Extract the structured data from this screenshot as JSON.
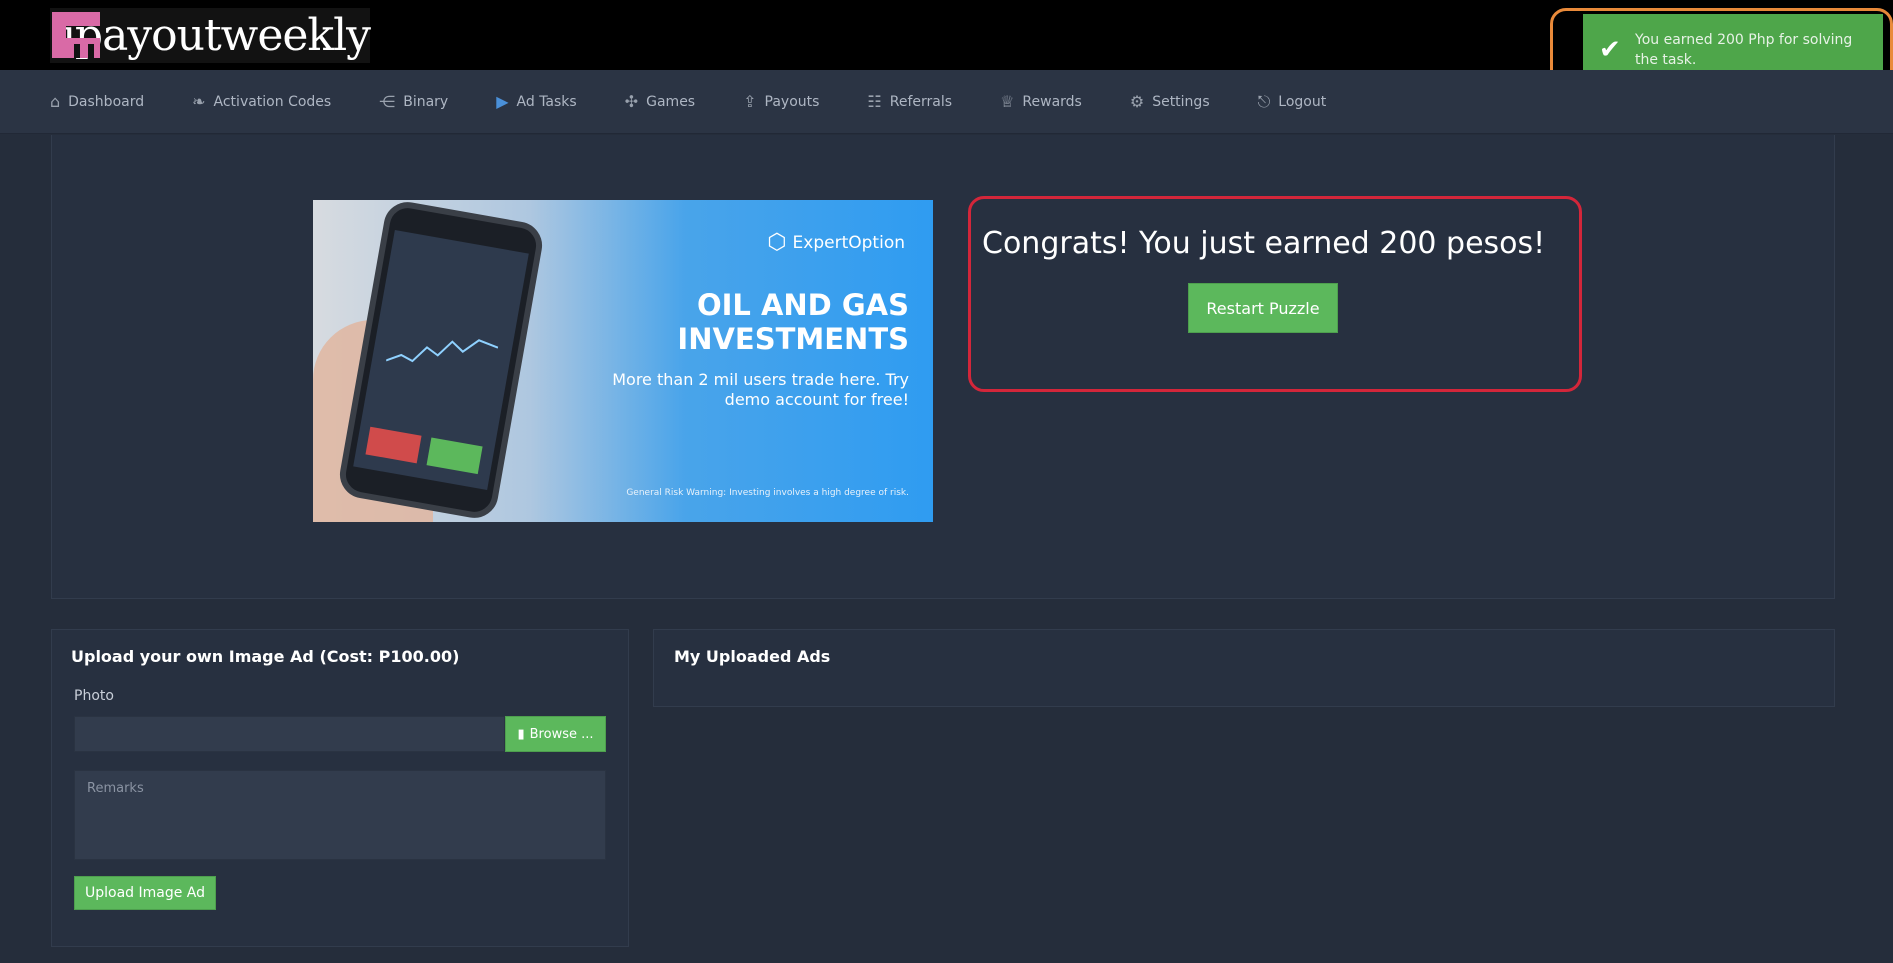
{
  "brand": {
    "logo_text": "ipayoutweekly"
  },
  "toast": {
    "message": "You earned 200 Php for solving the task.",
    "color": "#4ea64a"
  },
  "nav": {
    "items": [
      {
        "label": "Dashboard",
        "icon": "home-icon"
      },
      {
        "label": "Activation Codes",
        "icon": "leaf-icon"
      },
      {
        "label": "Binary",
        "icon": "share-icon"
      },
      {
        "label": "Ad Tasks",
        "icon": "play-icon",
        "active": true
      },
      {
        "label": "Games",
        "icon": "puzzle-icon"
      },
      {
        "label": "Payouts",
        "icon": "upload-icon"
      },
      {
        "label": "Referrals",
        "icon": "sitemap-icon"
      },
      {
        "label": "Rewards",
        "icon": "trophy-icon"
      },
      {
        "label": "Settings",
        "icon": "gears-icon"
      },
      {
        "label": "Logout",
        "icon": "sign-out-icon"
      }
    ]
  },
  "ad": {
    "brand": "ExpertOption",
    "headline": "OIL AND GAS INVESTMENTS",
    "subtext": "More than 2 mil users trade here. Try demo account for free!",
    "warning": "General Risk Warning: Investing involves a high degree of risk."
  },
  "congrats": {
    "title": "Congrats! You just earned 200 pesos!",
    "restart_label": "Restart Puzzle"
  },
  "upload": {
    "title": "Upload your own Image Ad (Cost: P100.00)",
    "photo_label": "Photo",
    "browse_label": "Browse ...",
    "remarks_placeholder": "Remarks",
    "submit_label": "Upload Image Ad"
  },
  "my_ads": {
    "title": "My Uploaded Ads"
  },
  "colors": {
    "accent_green": "#5cb85c",
    "highlight_red": "#d3263a",
    "highlight_orange": "#e98a3a"
  }
}
